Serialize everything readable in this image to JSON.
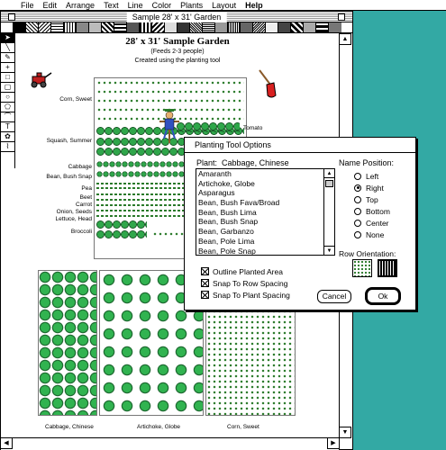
{
  "menubar": {
    "apple_glyph": "",
    "items": [
      "File",
      "Edit",
      "Arrange",
      "Text",
      "Line",
      "Color",
      "Plants",
      "Layout",
      "Help"
    ]
  },
  "window": {
    "title": "Sample 28' x 31' Garden"
  },
  "garden": {
    "title": "28' x 31' Sample Garden",
    "feeds": "(Feeds 2-3 people)",
    "created": "Created using the planting tool",
    "labels": {
      "corn": "Corn, Sweet",
      "squash": "Squash, Summer",
      "tomato": "Tomato",
      "cabbage": "Cabbage",
      "bean_bush_snap": "Bean, Bush Snap",
      "pea": "Pea",
      "beet": "Beet",
      "carrot": "Carrot",
      "onion": "Onion, Seeds",
      "lettuce": "Lettuce, Head",
      "broccoli": "Broccoli",
      "bottom_cabbage": "Cabbage, Chinese",
      "bottom_artichoke": "Artichoke, Globe",
      "bottom_corn": "Corn, Sweet"
    }
  },
  "dialog": {
    "title": "Planting Tool Options",
    "plant_label": "Plant:",
    "plant_value": "Cabbage, Chinese",
    "plants": [
      "Amaranth",
      "Artichoke, Globe",
      "Asparagus",
      "Bean, Bush Fava/Broad",
      "Bean, Bush Lima",
      "Bean, Bush Snap",
      "Bean, Garbanzo",
      "Bean, Pole Lima",
      "Bean, Pole Snap"
    ],
    "name_position_label": "Name Position:",
    "name_positions": [
      "Left",
      "Right",
      "Top",
      "Bottom",
      "Center",
      "None"
    ],
    "selected_name_position": "Right",
    "row_orientation_label": "Row Orientation:",
    "checkboxes": [
      "Outline Planted Area",
      "Snap To Row Spacing",
      "Snap To Plant Spacing"
    ],
    "cancel_label": "Cancel",
    "ok_label": "Ok"
  }
}
